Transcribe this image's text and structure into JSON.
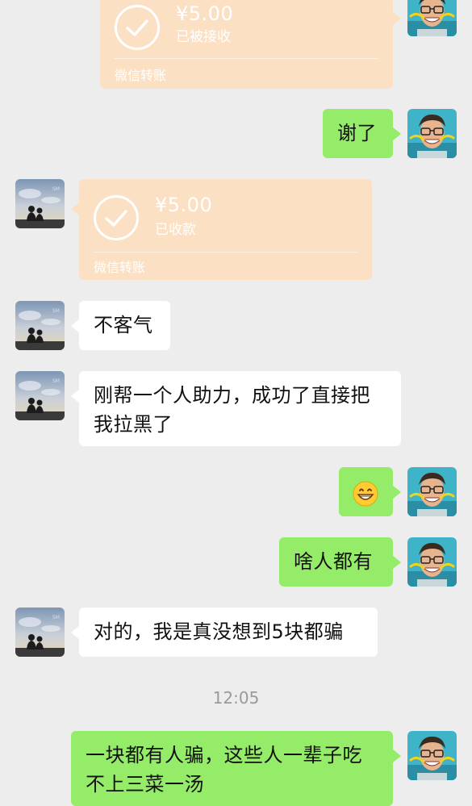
{
  "messages": [
    {
      "side": "right",
      "type": "transfer",
      "amount": "¥5.00",
      "status": "已被接收",
      "label": "微信转账"
    },
    {
      "side": "right",
      "type": "text",
      "text": "谢了"
    },
    {
      "side": "left",
      "type": "transfer",
      "amount": "¥5.00",
      "status": "已收款",
      "label": "微信转账"
    },
    {
      "side": "left",
      "type": "text",
      "text": "不客气"
    },
    {
      "side": "left",
      "type": "text",
      "text": "刚帮一个人助力，成功了直接把我拉黑了"
    },
    {
      "side": "right",
      "type": "emoji",
      "emoji": "grinning-face-emoji"
    },
    {
      "side": "right",
      "type": "text",
      "text": "啥人都有"
    },
    {
      "side": "left",
      "type": "text",
      "text": "对的，我是真没想到5块都骗"
    },
    {
      "side": "right",
      "type": "text",
      "text": "一块都有人骗，这些人一辈子吃不上三菜一汤"
    }
  ],
  "timestamp": "12:05",
  "colors": {
    "background": "#ededed",
    "sent_bubble": "#95ec69",
    "received_bubble": "#ffffff",
    "transfer_card": "#fbe0c4"
  }
}
